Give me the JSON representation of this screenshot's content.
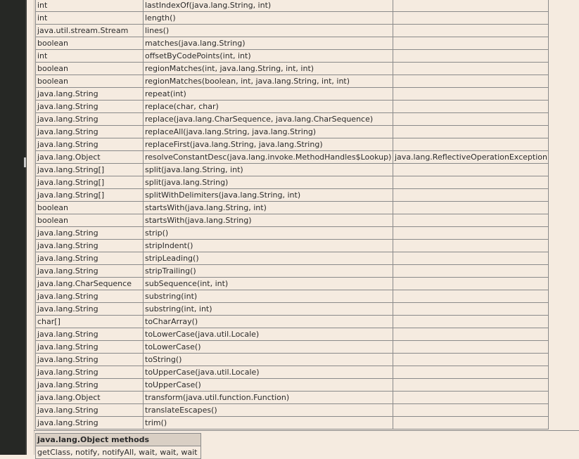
{
  "methods_table": {
    "rows": [
      {
        "type": "int",
        "method": "lastIndexOf(java.lang.String, int)",
        "throws": ""
      },
      {
        "type": "int",
        "method": "length()",
        "throws": ""
      },
      {
        "type": "java.util.stream.Stream",
        "method": "lines()",
        "throws": ""
      },
      {
        "type": "boolean",
        "method": "matches(java.lang.String)",
        "throws": ""
      },
      {
        "type": "int",
        "method": "offsetByCodePoints(int, int)",
        "throws": ""
      },
      {
        "type": "boolean",
        "method": "regionMatches(int, java.lang.String, int, int)",
        "throws": ""
      },
      {
        "type": "boolean",
        "method": "regionMatches(boolean, int, java.lang.String, int, int)",
        "throws": ""
      },
      {
        "type": "java.lang.String",
        "method": "repeat(int)",
        "throws": ""
      },
      {
        "type": "java.lang.String",
        "method": "replace(char, char)",
        "throws": ""
      },
      {
        "type": "java.lang.String",
        "method": "replace(java.lang.CharSequence, java.lang.CharSequence)",
        "throws": ""
      },
      {
        "type": "java.lang.String",
        "method": "replaceAll(java.lang.String, java.lang.String)",
        "throws": ""
      },
      {
        "type": "java.lang.String",
        "method": "replaceFirst(java.lang.String, java.lang.String)",
        "throws": ""
      },
      {
        "type": "java.lang.Object",
        "method": "resolveConstantDesc(java.lang.invoke.MethodHandles$Lookup)",
        "throws": "java.lang.ReflectiveOperationException"
      },
      {
        "type": "java.lang.String[]",
        "method": "split(java.lang.String, int)",
        "throws": ""
      },
      {
        "type": "java.lang.String[]",
        "method": "split(java.lang.String)",
        "throws": ""
      },
      {
        "type": "java.lang.String[]",
        "method": "splitWithDelimiters(java.lang.String, int)",
        "throws": ""
      },
      {
        "type": "boolean",
        "method": "startsWith(java.lang.String, int)",
        "throws": ""
      },
      {
        "type": "boolean",
        "method": "startsWith(java.lang.String)",
        "throws": ""
      },
      {
        "type": "java.lang.String",
        "method": "strip()",
        "throws": ""
      },
      {
        "type": "java.lang.String",
        "method": "stripIndent()",
        "throws": ""
      },
      {
        "type": "java.lang.String",
        "method": "stripLeading()",
        "throws": ""
      },
      {
        "type": "java.lang.String",
        "method": "stripTrailing()",
        "throws": ""
      },
      {
        "type": "java.lang.CharSequence",
        "method": "subSequence(int, int)",
        "throws": ""
      },
      {
        "type": "java.lang.String",
        "method": "substring(int)",
        "throws": ""
      },
      {
        "type": "java.lang.String",
        "method": "substring(int, int)",
        "throws": ""
      },
      {
        "type": "char[]",
        "method": "toCharArray()",
        "throws": ""
      },
      {
        "type": "java.lang.String",
        "method": "toLowerCase(java.util.Locale)",
        "throws": ""
      },
      {
        "type": "java.lang.String",
        "method": "toLowerCase()",
        "throws": ""
      },
      {
        "type": "java.lang.String",
        "method": "toString()",
        "throws": ""
      },
      {
        "type": "java.lang.String",
        "method": "toUpperCase(java.util.Locale)",
        "throws": ""
      },
      {
        "type": "java.lang.String",
        "method": "toUpperCase()",
        "throws": ""
      },
      {
        "type": "java.lang.Object",
        "method": "transform(java.util.function.Function)",
        "throws": ""
      },
      {
        "type": "java.lang.String",
        "method": "translateEscapes()",
        "throws": ""
      },
      {
        "type": "java.lang.String",
        "method": "trim()",
        "throws": ""
      }
    ]
  },
  "object_methods": {
    "header": "java.lang.Object methods",
    "list": "getClass, notify, notifyAll, wait, wait, wait"
  },
  "colors": {
    "background": "#f5ebe0",
    "sidebar": "#262825",
    "header_bg": "#d9cfc4",
    "border": "#8a8a8a"
  }
}
